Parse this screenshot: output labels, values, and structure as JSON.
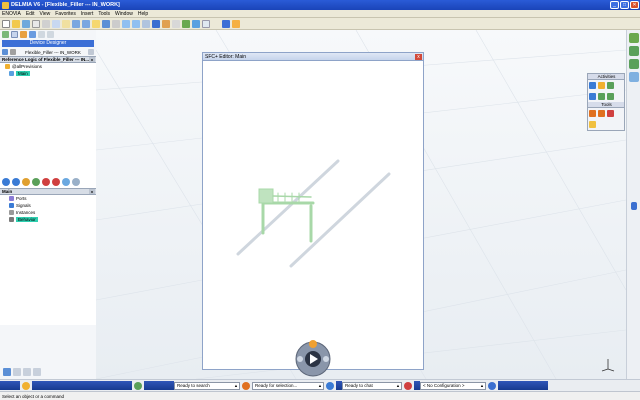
{
  "window": {
    "title": "DELMIA V6 - [Flexible_Filler --- IN_WORK]",
    "min": "_",
    "max": "□",
    "close": "✕"
  },
  "menu": [
    "ENOVIA",
    "Edit",
    "View",
    "Favorites",
    "Insert",
    "Tools",
    "Window",
    "Help"
  ],
  "left_panel": {
    "designer_label": "Device Designer",
    "context_label": "Flexible_Filler --- IN_WORK",
    "ref_logic_title": "Reference Logic of Flexible_Filler --- IN...",
    "tree": [
      {
        "label": "@allPrevisions"
      },
      {
        "label": "Main"
      }
    ],
    "main_title": "Main",
    "main_items": [
      "Ports",
      "Signals",
      "Instances",
      "Behavior"
    ]
  },
  "editor": {
    "title": "SFC+ Editor: Main"
  },
  "activities": {
    "title": "Activities",
    "tools_title": "Tools"
  },
  "status": {
    "search": "Ready to search",
    "selection": "Ready for selection...",
    "chat": "Ready to chat",
    "config": "< No Configuration >"
  },
  "command_line": "Select an object or a command",
  "colors": {
    "title_bar": "#1a44b8",
    "accent": "#2ecfb0",
    "model": "#9ed89e"
  }
}
